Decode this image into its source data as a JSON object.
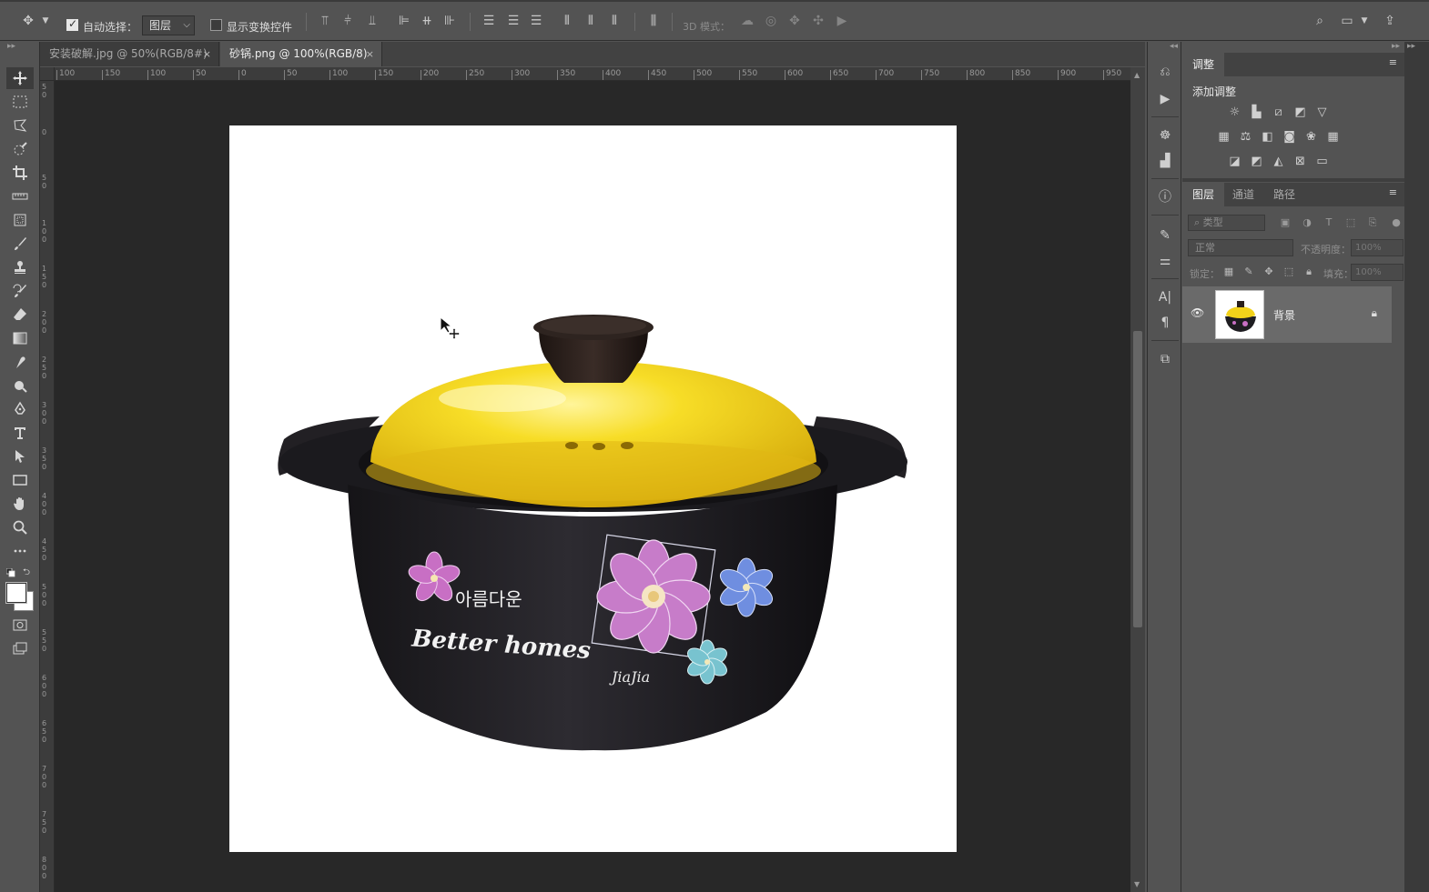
{
  "options_bar": {
    "auto_select_label": "自动选择：",
    "auto_select_checked": true,
    "auto_select_target": "图层",
    "show_transform_label": "显示变换控件",
    "show_transform_checked": false,
    "three_d_mode_label": "3D 模式："
  },
  "tabs": [
    {
      "label": "安装破解.jpg @ 50%(RGB/8#)",
      "close": "×",
      "active": false
    },
    {
      "label": "砂锅.png @ 100%(RGB/8)",
      "close": "×",
      "active": true
    }
  ],
  "ruler": {
    "h_ticks": [
      "100",
      "150",
      "100",
      "50",
      "0",
      "50",
      "100",
      "150",
      "200",
      "250",
      "300",
      "350",
      "400",
      "450",
      "500",
      "550",
      "600",
      "650",
      "700",
      "750",
      "800",
      "850",
      "900",
      "950"
    ],
    "v_ticks": [
      "50",
      "0",
      "50",
      "100",
      "150",
      "200",
      "250",
      "300",
      "350",
      "400",
      "450",
      "500",
      "550",
      "600",
      "650",
      "700",
      "750",
      "800"
    ]
  },
  "toolbar": {
    "tools": [
      "move-tool",
      "marquee-tool",
      "lasso-tool",
      "quick-select-tool",
      "crop-tool",
      "ruler-tool",
      "frame-tool",
      "brush-tool",
      "stamp-tool",
      "history-brush-tool",
      "eraser-tool",
      "gradient-tool",
      "smudge-tool",
      "dodge-tool",
      "pen-tool",
      "type-tool",
      "path-select-tool",
      "rectangle-tool",
      "hand-tool",
      "zoom-tool",
      "more-tools"
    ]
  },
  "adjustments_panel": {
    "tab": "调整",
    "title": "添加调整"
  },
  "layers_panel": {
    "tabs": [
      "图层",
      "通道",
      "路径"
    ],
    "filter_placeholder": "类型",
    "blend_mode": "正常",
    "opacity_label": "不透明度：",
    "opacity_value": "100%",
    "lock_label": "锁定：",
    "fill_label": "填充：",
    "fill_value": "100%",
    "layers": [
      {
        "name": "背景",
        "visible": true,
        "locked": true
      }
    ]
  },
  "canvas": {
    "product_text_korean": "아름다운",
    "product_text_english": "Better homes",
    "product_brand": "JiaJia"
  },
  "colors": {
    "ui_bg": "#535353",
    "workspace": "#282828",
    "pot_body": "#1f1d22",
    "lid": "#f3d21a",
    "flower_pink": "#c86fc4",
    "flower_blue": "#6f8ee0",
    "flower_teal": "#78c3cf"
  }
}
